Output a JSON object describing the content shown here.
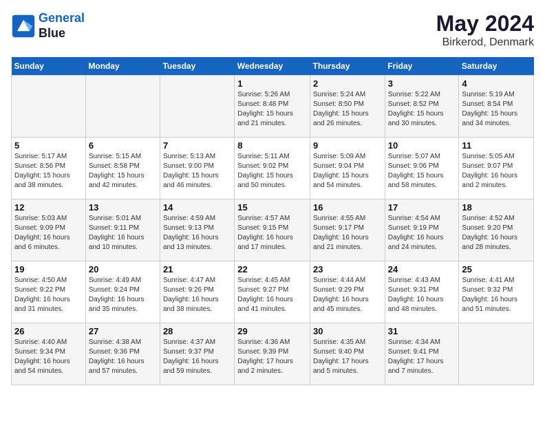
{
  "header": {
    "logo_line1": "General",
    "logo_line2": "Blue",
    "title": "May 2024",
    "subtitle": "Birkerod, Denmark"
  },
  "days_of_week": [
    "Sunday",
    "Monday",
    "Tuesday",
    "Wednesday",
    "Thursday",
    "Friday",
    "Saturday"
  ],
  "weeks": [
    [
      {
        "day": "",
        "info": ""
      },
      {
        "day": "",
        "info": ""
      },
      {
        "day": "",
        "info": ""
      },
      {
        "day": "1",
        "info": "Sunrise: 5:26 AM\nSunset: 8:48 PM\nDaylight: 15 hours\nand 21 minutes."
      },
      {
        "day": "2",
        "info": "Sunrise: 5:24 AM\nSunset: 8:50 PM\nDaylight: 15 hours\nand 26 minutes."
      },
      {
        "day": "3",
        "info": "Sunrise: 5:22 AM\nSunset: 8:52 PM\nDaylight: 15 hours\nand 30 minutes."
      },
      {
        "day": "4",
        "info": "Sunrise: 5:19 AM\nSunset: 8:54 PM\nDaylight: 15 hours\nand 34 minutes."
      }
    ],
    [
      {
        "day": "5",
        "info": "Sunrise: 5:17 AM\nSunset: 8:56 PM\nDaylight: 15 hours\nand 38 minutes."
      },
      {
        "day": "6",
        "info": "Sunrise: 5:15 AM\nSunset: 8:58 PM\nDaylight: 15 hours\nand 42 minutes."
      },
      {
        "day": "7",
        "info": "Sunrise: 5:13 AM\nSunset: 9:00 PM\nDaylight: 15 hours\nand 46 minutes."
      },
      {
        "day": "8",
        "info": "Sunrise: 5:11 AM\nSunset: 9:02 PM\nDaylight: 15 hours\nand 50 minutes."
      },
      {
        "day": "9",
        "info": "Sunrise: 5:09 AM\nSunset: 9:04 PM\nDaylight: 15 hours\nand 54 minutes."
      },
      {
        "day": "10",
        "info": "Sunrise: 5:07 AM\nSunset: 9:06 PM\nDaylight: 15 hours\nand 58 minutes."
      },
      {
        "day": "11",
        "info": "Sunrise: 5:05 AM\nSunset: 9:07 PM\nDaylight: 16 hours\nand 2 minutes."
      }
    ],
    [
      {
        "day": "12",
        "info": "Sunrise: 5:03 AM\nSunset: 9:09 PM\nDaylight: 16 hours\nand 6 minutes."
      },
      {
        "day": "13",
        "info": "Sunrise: 5:01 AM\nSunset: 9:11 PM\nDaylight: 16 hours\nand 10 minutes."
      },
      {
        "day": "14",
        "info": "Sunrise: 4:59 AM\nSunset: 9:13 PM\nDaylight: 16 hours\nand 13 minutes."
      },
      {
        "day": "15",
        "info": "Sunrise: 4:57 AM\nSunset: 9:15 PM\nDaylight: 16 hours\nand 17 minutes."
      },
      {
        "day": "16",
        "info": "Sunrise: 4:55 AM\nSunset: 9:17 PM\nDaylight: 16 hours\nand 21 minutes."
      },
      {
        "day": "17",
        "info": "Sunrise: 4:54 AM\nSunset: 9:19 PM\nDaylight: 16 hours\nand 24 minutes."
      },
      {
        "day": "18",
        "info": "Sunrise: 4:52 AM\nSunset: 9:20 PM\nDaylight: 16 hours\nand 28 minutes."
      }
    ],
    [
      {
        "day": "19",
        "info": "Sunrise: 4:50 AM\nSunset: 9:22 PM\nDaylight: 16 hours\nand 31 minutes."
      },
      {
        "day": "20",
        "info": "Sunrise: 4:49 AM\nSunset: 9:24 PM\nDaylight: 16 hours\nand 35 minutes."
      },
      {
        "day": "21",
        "info": "Sunrise: 4:47 AM\nSunset: 9:26 PM\nDaylight: 16 hours\nand 38 minutes."
      },
      {
        "day": "22",
        "info": "Sunrise: 4:45 AM\nSunset: 9:27 PM\nDaylight: 16 hours\nand 41 minutes."
      },
      {
        "day": "23",
        "info": "Sunrise: 4:44 AM\nSunset: 9:29 PM\nDaylight: 16 hours\nand 45 minutes."
      },
      {
        "day": "24",
        "info": "Sunrise: 4:43 AM\nSunset: 9:31 PM\nDaylight: 16 hours\nand 48 minutes."
      },
      {
        "day": "25",
        "info": "Sunrise: 4:41 AM\nSunset: 9:32 PM\nDaylight: 16 hours\nand 51 minutes."
      }
    ],
    [
      {
        "day": "26",
        "info": "Sunrise: 4:40 AM\nSunset: 9:34 PM\nDaylight: 16 hours\nand 54 minutes."
      },
      {
        "day": "27",
        "info": "Sunrise: 4:38 AM\nSunset: 9:36 PM\nDaylight: 16 hours\nand 57 minutes."
      },
      {
        "day": "28",
        "info": "Sunrise: 4:37 AM\nSunset: 9:37 PM\nDaylight: 16 hours\nand 59 minutes."
      },
      {
        "day": "29",
        "info": "Sunrise: 4:36 AM\nSunset: 9:39 PM\nDaylight: 17 hours\nand 2 minutes."
      },
      {
        "day": "30",
        "info": "Sunrise: 4:35 AM\nSunset: 9:40 PM\nDaylight: 17 hours\nand 5 minutes."
      },
      {
        "day": "31",
        "info": "Sunrise: 4:34 AM\nSunset: 9:41 PM\nDaylight: 17 hours\nand 7 minutes."
      },
      {
        "day": "",
        "info": ""
      }
    ]
  ]
}
